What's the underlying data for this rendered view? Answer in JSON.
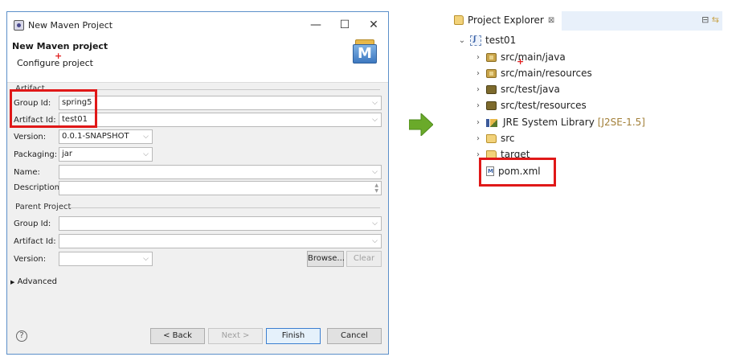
{
  "dialog": {
    "title": "New Maven Project",
    "header_title": "New Maven project",
    "header_subtitle": "Configure project",
    "minimize_glyph": "—",
    "maximize_glyph": "☐",
    "close_glyph": "✕"
  },
  "artifact": {
    "section": "Artifact",
    "group_id_label": "Group Id:",
    "group_id_value": "spring5",
    "artifact_id_label": "Artifact Id:",
    "artifact_id_value": "test01",
    "version_label": "Version:",
    "version_value": "0.0.1-SNAPSHOT",
    "packaging_label": "Packaging:",
    "packaging_value": "jar",
    "name_label": "Name:",
    "name_value": "",
    "description_label": "Description:",
    "description_value": ""
  },
  "parent": {
    "section": "Parent Project",
    "group_id_label": "Group Id:",
    "artifact_id_label": "Artifact Id:",
    "version_label": "Version:",
    "browse_label": "Browse...",
    "clear_label": "Clear"
  },
  "advanced_label": "Advanced",
  "footer": {
    "help_glyph": "?",
    "back_label": "< Back",
    "next_label": "Next >",
    "finish_label": "Finish",
    "cancel_label": "Cancel"
  },
  "explorer": {
    "tab_label": "Project Explorer",
    "tab_close": "⊠",
    "project": "test01",
    "items": [
      {
        "label": "src/main/java",
        "icon": "package-folder-icon"
      },
      {
        "label": "src/main/resources",
        "icon": "package-folder-icon"
      },
      {
        "label": "src/test/java",
        "icon": "package-folder-icon"
      },
      {
        "label": "src/test/resources",
        "icon": "package-folder-icon"
      },
      {
        "label": "JRE System Library",
        "decoration": "[J2SE-1.5]",
        "icon": "library-icon"
      },
      {
        "label": "src",
        "icon": "folder-icon"
      },
      {
        "label": "target",
        "icon": "folder-icon"
      },
      {
        "label": "pom.xml",
        "icon": "maven-file-icon"
      }
    ]
  },
  "colors": {
    "highlight": "#e01818",
    "arrow": "#6aaa2a",
    "dialog_border": "#5b8fc9"
  }
}
